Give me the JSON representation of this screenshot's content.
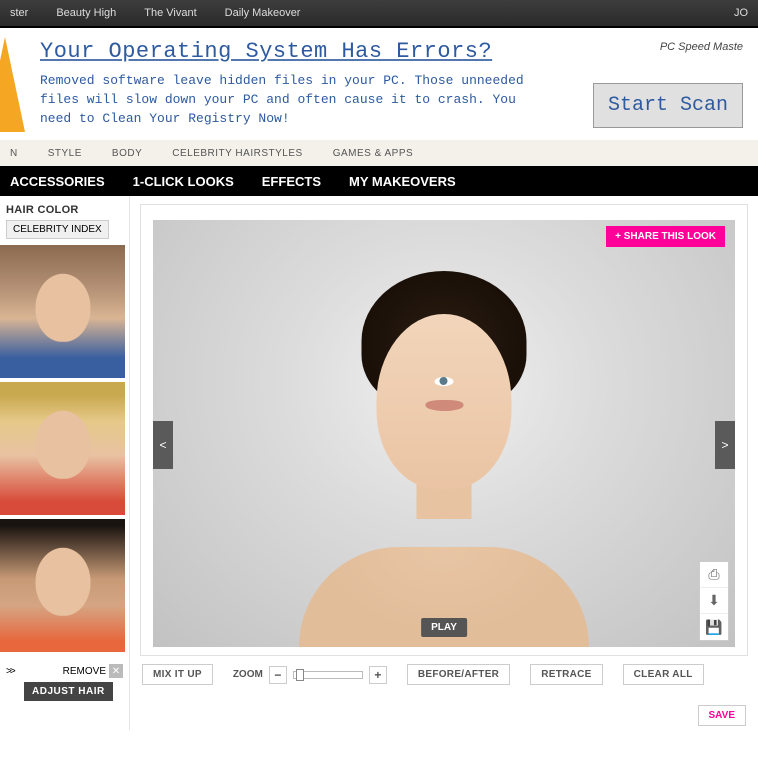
{
  "topbar": {
    "items": [
      "ster",
      "Beauty High",
      "The Vivant",
      "Daily Makeover"
    ],
    "right": "JO"
  },
  "ad": {
    "title": "Your Operating System Has Errors?",
    "body": "Removed software leave hidden files in your PC. Those unneeded files will slow down your PC and often cause it to crash. You need to Clean Your Registry Now!",
    "brand": "PC Speed Maste",
    "cta": "Start Scan"
  },
  "menu_light": {
    "items": [
      "N",
      "STYLE",
      "BODY",
      "CELEBRITY HAIRSTYLES",
      "GAMES & APPS"
    ]
  },
  "menu_dark": {
    "items": [
      "ACCESSORIES",
      "1-CLICK LOOKS",
      "EFFECTS",
      "MY MAKEOVERS"
    ]
  },
  "sidebar": {
    "header": "HAIR COLOR",
    "celeb_index": "CELEBRITY INDEX",
    "arrows": ">>",
    "remove": "REMOVE",
    "remove_x": "✕",
    "adjust": "ADJUST HAIR"
  },
  "canvas": {
    "share": "+ SHARE THIS LOOK",
    "prev": "<",
    "next": ">",
    "play": "PLAY"
  },
  "tool_icons": {
    "print": "⎙",
    "download": "⬇",
    "save_disk": "💾"
  },
  "toolbar": {
    "mix": "MIX IT UP",
    "zoom_label": "ZOOM",
    "minus": "−",
    "plus": "+",
    "before_after": "BEFORE/AFTER",
    "retrace": "RETRACE",
    "clear": "CLEAR ALL",
    "save": "SAVE"
  }
}
